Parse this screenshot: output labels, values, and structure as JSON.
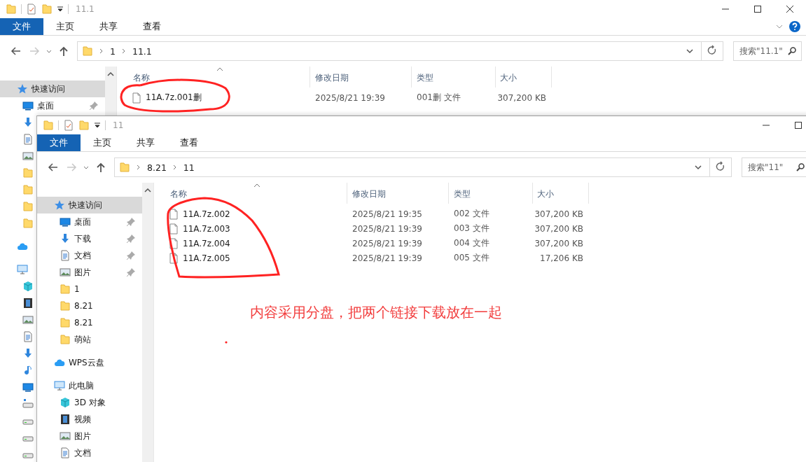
{
  "windows": [
    {
      "title": "11.1",
      "tabs": [
        {
          "label": "文件",
          "selected": true
        },
        {
          "label": "主页",
          "selected": false
        },
        {
          "label": "共享",
          "selected": false
        },
        {
          "label": "查看",
          "selected": false
        }
      ],
      "help": true,
      "controls": [
        {
          "kind": "minimize"
        },
        {
          "kind": "maximize"
        },
        {
          "kind": "close"
        }
      ],
      "path": [
        "1",
        "11.1"
      ],
      "search": {
        "placeholder": "搜索\"11.1\""
      },
      "sidebar": [
        {
          "kind": "star",
          "label": "快速访问",
          "selected": true,
          "children": [
            {
              "kind": "desktop",
              "label": "桌面",
              "pinned": true
            },
            {
              "kind": "download"
            },
            {
              "kind": "doc"
            },
            {
              "kind": "picture"
            },
            {
              "kind": "folder"
            },
            {
              "kind": "folder"
            },
            {
              "kind": "folder"
            },
            {
              "kind": "folder"
            }
          ]
        },
        {
          "kind": "cloud"
        },
        {
          "kind": "pc",
          "children": [
            {
              "kind": "cube"
            },
            {
              "kind": "film"
            },
            {
              "kind": "picture"
            },
            {
              "kind": "doc"
            },
            {
              "kind": "download"
            },
            {
              "kind": "music"
            },
            {
              "kind": "desktop"
            },
            {
              "kind": "netdrive"
            },
            {
              "kind": "drive"
            },
            {
              "kind": "drive"
            },
            {
              "kind": "drive"
            }
          ]
        }
      ],
      "columns": [
        "名称",
        "修改日期",
        "类型",
        "大小"
      ],
      "files": [
        {
          "name": "11A.7z.001删",
          "date": "2025/8/21 19:39",
          "type": "001删 文件",
          "size": "307,200 KB"
        }
      ]
    },
    {
      "title": "11",
      "tabs": [
        {
          "label": "文件",
          "selected": true
        },
        {
          "label": "主页",
          "selected": false
        },
        {
          "label": "共享",
          "selected": false
        },
        {
          "label": "查看",
          "selected": false
        }
      ],
      "controls": [
        {
          "kind": "minimize"
        },
        {
          "kind": "maximize"
        }
      ],
      "path": [
        "8.21",
        "11"
      ],
      "search": {
        "placeholder": "搜索\"11\""
      },
      "sidebar": [
        {
          "kind": "star",
          "label": "快速访问",
          "selected": true,
          "children": [
            {
              "kind": "desktop",
              "label": "桌面",
              "pinned": true
            },
            {
              "kind": "download",
              "label": "下载",
              "pinned": true
            },
            {
              "kind": "doc",
              "label": "文档",
              "pinned": true
            },
            {
              "kind": "picture",
              "label": "图片",
              "pinned": true
            },
            {
              "kind": "folder",
              "label": "1",
              "pinned": false
            },
            {
              "kind": "folder",
              "label": "8.21",
              "pinned": false
            },
            {
              "kind": "folder",
              "label": "8.21",
              "pinned": false
            },
            {
              "kind": "folder",
              "label": "萌站",
              "pinned": false
            }
          ]
        },
        {
          "kind": "cloud",
          "label": "WPS云盘",
          "selected": false
        },
        {
          "kind": "pc",
          "label": "此电脑",
          "selected": false,
          "children": [
            {
              "kind": "cube",
              "label": "3D 对象"
            },
            {
              "kind": "film",
              "label": "视频"
            },
            {
              "kind": "picture",
              "label": "图片"
            },
            {
              "kind": "doc",
              "label": "文档"
            }
          ]
        }
      ],
      "columns": [
        "名称",
        "修改日期",
        "类型",
        "大小"
      ],
      "files": [
        {
          "name": "11A.7z.002",
          "date": "2025/8/21 19:35",
          "type": "002 文件",
          "size": "307,200 KB"
        },
        {
          "name": "11A.7z.003",
          "date": "2025/8/21 19:39",
          "type": "003 文件",
          "size": "307,200 KB"
        },
        {
          "name": "11A.7z.004",
          "date": "2025/8/21 19:39",
          "type": "004 文件",
          "size": "307,200 KB"
        },
        {
          "name": "11A.7z.005",
          "date": "2025/8/21 19:39",
          "type": "005 文件",
          "size": "17,206 KB"
        }
      ]
    }
  ],
  "annotation_note": "内容采用分盘，把两个链接下载放在一起"
}
